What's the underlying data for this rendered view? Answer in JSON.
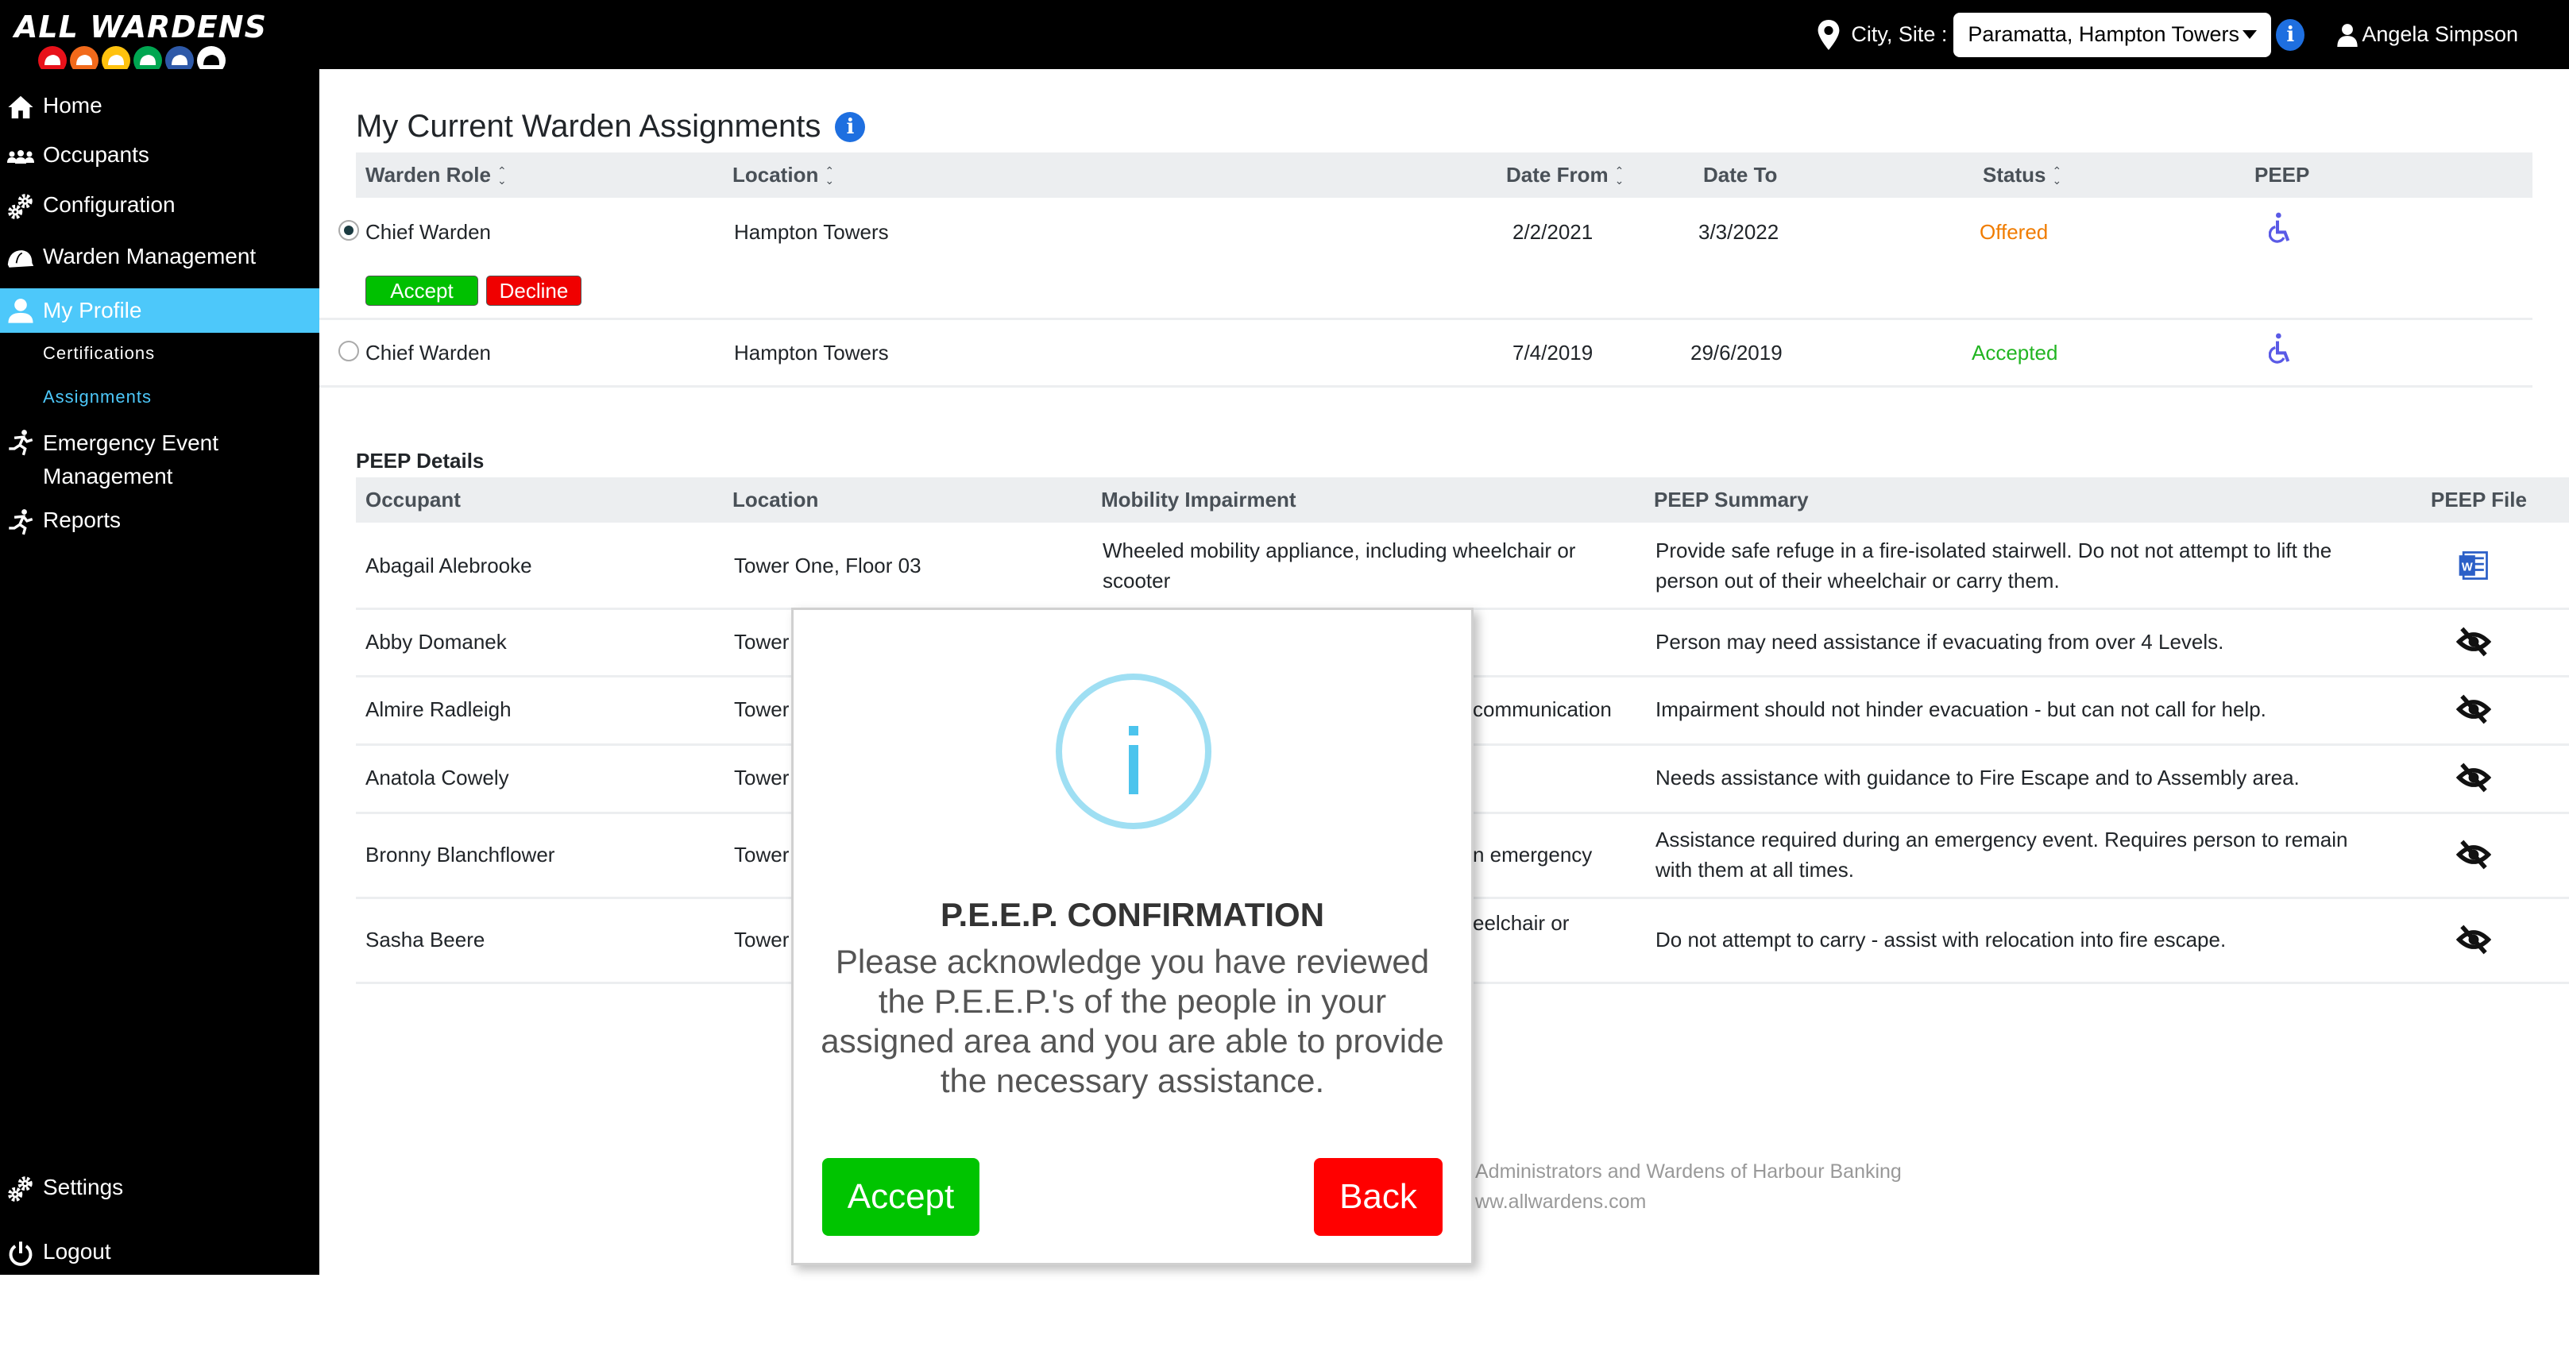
{
  "app": {
    "logo_text": "ALL WARDENS",
    "hat_colors": [
      "#e8111a",
      "#f26a1b",
      "#ffc20e",
      "#00a651",
      "#2e59a8",
      "#ffffff"
    ]
  },
  "topbar": {
    "site_label": "City, Site :",
    "site_value": "Paramatta, Hampton Towers",
    "user_name": "Angela Simpson"
  },
  "sidebar": {
    "items": [
      {
        "label": "Home",
        "icon": "home-icon"
      },
      {
        "label": "Occupants",
        "icon": "users-icon"
      },
      {
        "label": "Configuration",
        "icon": "gears-icon"
      },
      {
        "label": "Warden Management",
        "icon": "hard-hat-icon"
      },
      {
        "label": "My Profile",
        "icon": "user-icon",
        "active": true
      },
      {
        "label": "Emergency Event Management",
        "icon": "running-icon"
      },
      {
        "label": "Reports",
        "icon": "running-icon"
      },
      {
        "label": "Settings",
        "icon": "gears-icon"
      },
      {
        "label": "Logout",
        "icon": "power-icon"
      }
    ],
    "sub_items": [
      {
        "label": "Certifications"
      },
      {
        "label": "Assignments",
        "active": true
      }
    ],
    "active_color": "#4dc8fa"
  },
  "assignments": {
    "title": "My Current Warden Assignments",
    "columns": [
      "Warden Role",
      "Location",
      "Date From",
      "Date To",
      "Status",
      "PEEP"
    ],
    "rows": [
      {
        "role": "Chief Warden",
        "location": "Hampton Towers",
        "date_from": "2/2/2021",
        "date_to": "3/3/2022",
        "status": "Offered",
        "selected": true
      },
      {
        "role": "Chief Warden",
        "location": "Hampton Towers",
        "date_from": "7/4/2019",
        "date_to": "29/6/2019",
        "status": "Accepted",
        "selected": false
      }
    ],
    "accept_label": "Accept",
    "decline_label": "Decline",
    "status_colors": {
      "Offered": "#f07c00",
      "Accepted": "#22b522"
    }
  },
  "peep": {
    "title": "PEEP Details",
    "columns": [
      "Occupant",
      "Location",
      "Mobility Impairment",
      "PEEP Summary",
      "PEEP File"
    ],
    "rows": [
      {
        "occupant": "Abagail Alebrooke",
        "location": "Tower One, Floor 03",
        "impairment": "Wheeled mobility appliance, including wheelchair or scooter",
        "summary": "Provide safe refuge in a fire-isolated stairwell. Do not not attempt to lift the person out of their wheelchair or carry them.",
        "file": "word-file-icon"
      },
      {
        "occupant": "Abby Domanek",
        "location": "Tower",
        "impairment": "",
        "summary": "Person may need assistance if evacuating from over 4 Levels.",
        "file": "eye-slash-icon"
      },
      {
        "occupant": "Almire Radleigh",
        "location": "Tower",
        "impairment": "communication",
        "summary": "Impairment should not hinder evacuation - but can not call for help.",
        "file": "eye-slash-icon"
      },
      {
        "occupant": "Anatola Cowely",
        "location": "Tower",
        "impairment": "",
        "summary": "Needs assistance with guidance to Fire Escape and to Assembly area.",
        "file": "eye-slash-icon"
      },
      {
        "occupant": "Bronny Blanchflower",
        "location": "Tower",
        "impairment": "n emergency",
        "summary": "Assistance required during an emergency event. Requires person to remain with them at all times.",
        "file": "eye-slash-icon"
      },
      {
        "occupant": "Sasha Beere",
        "location": "Tower",
        "impairment": "eelchair or",
        "summary": "Do not attempt to carry - assist with relocation into fire escape.",
        "file": "eye-slash-icon"
      }
    ]
  },
  "footer": {
    "line1": "Administrators and Wardens of Harbour Banking",
    "line2": "ww.allwardens.com"
  },
  "modal": {
    "title": "P.E.E.P. CONFIRMATION",
    "body": "Please acknowledge you have reviewed the P.E.E.P.'s of the people in your assigned area and you are able to provide the necessary assistance.",
    "accept_label": "Accept",
    "back_label": "Back"
  }
}
